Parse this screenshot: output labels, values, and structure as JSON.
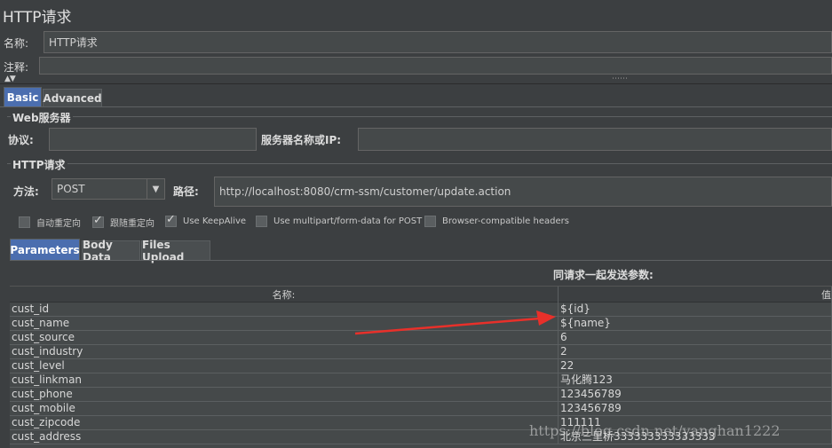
{
  "window": {
    "title": "HTTP请求"
  },
  "form": {
    "name_label": "名称:",
    "name_value": "HTTP请求",
    "comment_label": "注释:",
    "comment_value": ""
  },
  "tabs": [
    {
      "label": "Basic",
      "active": true
    },
    {
      "label": "Advanced",
      "active": false
    }
  ],
  "web_server": {
    "group_title": "Web服务器",
    "protocol_label": "协议:",
    "protocol_value": "",
    "server_label": "服务器名称或IP:",
    "server_value": ""
  },
  "http_request": {
    "group_title": "HTTP请求",
    "method_label": "方法:",
    "method_value": "POST",
    "path_label": "路径:",
    "path_value": "http://localhost:8080/crm-ssm/customer/update.action"
  },
  "checkboxes": [
    {
      "label": "自动重定向",
      "checked": false
    },
    {
      "label": "跟随重定向",
      "checked": true
    },
    {
      "label": "Use KeepAlive",
      "checked": true
    },
    {
      "label": "Use multipart/form-data for POST",
      "checked": false
    },
    {
      "label": "Browser-compatible headers",
      "checked": false
    }
  ],
  "param_tabs": [
    {
      "label": "Parameters",
      "active": true
    },
    {
      "label": "Body Data",
      "active": false
    },
    {
      "label": "Files Upload",
      "active": false
    }
  ],
  "params": {
    "caption": "同请求一起发送参数:",
    "columns": [
      "名称:",
      "值"
    ],
    "rows": [
      [
        "cust_id",
        "${id}"
      ],
      [
        "cust_name",
        "${name}"
      ],
      [
        "cust_source",
        "6"
      ],
      [
        "cust_industry",
        "2"
      ],
      [
        "cust_level",
        "22"
      ],
      [
        "cust_linkman",
        "马化腾123"
      ],
      [
        "cust_phone",
        "123456789"
      ],
      [
        "cust_mobile",
        "123456789"
      ],
      [
        "cust_zipcode",
        "111111"
      ],
      [
        "cust_address",
        "北京三里桥333333333333333"
      ]
    ]
  },
  "watermark": "https://blog.csdn.net/yanghan1222",
  "colors": {
    "background": "#3c3f41",
    "field": "#45494a",
    "active_tab": "#4b6eaf",
    "arrow": "#e8302a"
  }
}
